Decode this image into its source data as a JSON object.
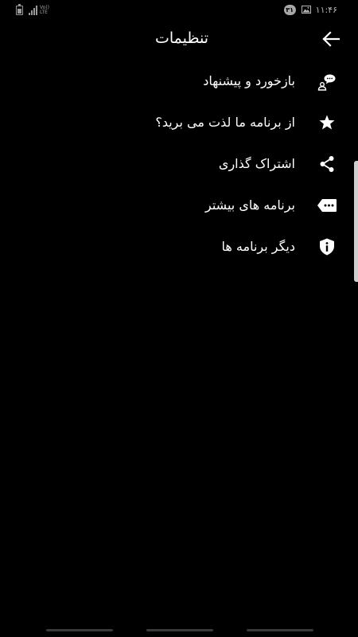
{
  "status_bar": {
    "time": "۱۱:۴۶",
    "notification_count": "۳۱",
    "network_top": "Vo))",
    "network_bottom": "LTE",
    "icons": [
      "battery-icon",
      "signal-icon",
      "volte-lte-icon",
      "notification-badge-icon",
      "gallery-icon"
    ]
  },
  "toolbar": {
    "title": "تنظیمات",
    "back_icon": "arrow-back-icon"
  },
  "menu": {
    "items": [
      {
        "label": "بازخورد و پیشنهاد",
        "icon": "feedback-chat-icon"
      },
      {
        "label": "از برنامه ما لذت می برید؟",
        "icon": "star-icon"
      },
      {
        "label": "اشتراک گذاری",
        "icon": "share-icon"
      },
      {
        "label": "برنامه های بیشتر",
        "icon": "more-apps-tag-icon"
      },
      {
        "label": "دیگر برنامه ها",
        "icon": "info-shield-icon"
      }
    ]
  },
  "colors": {
    "background": "#000000",
    "text": "#ffffff",
    "status_text": "#b5b5b5",
    "scrollbar": "#cfcfcf"
  }
}
